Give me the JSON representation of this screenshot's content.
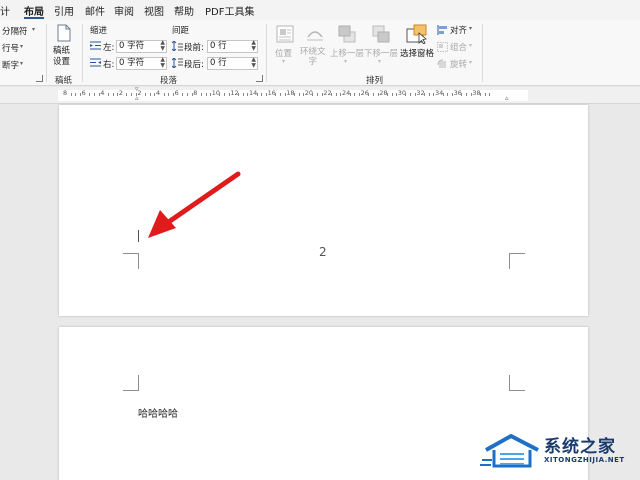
{
  "menu": {
    "tabs": [
      {
        "label": "计"
      },
      {
        "label": "布局"
      },
      {
        "label": "引用"
      },
      {
        "label": "邮件"
      },
      {
        "label": "审阅"
      },
      {
        "label": "视图"
      },
      {
        "label": "帮助"
      },
      {
        "label": "PDF工具集"
      }
    ],
    "active": "布局"
  },
  "ribbon": {
    "setup": {
      "breaks": "分隔符",
      "line_numbers": "行号",
      "hyphenation": "断字"
    },
    "draft": {
      "button": "稿纸\n设置",
      "group": "稿纸"
    },
    "paragraph": {
      "indent_title": "缩进",
      "spacing_title": "间距",
      "left_label": "左:",
      "right_label": "右:",
      "before_label": "段前:",
      "after_label": "段后:",
      "left_value": "0 字符",
      "right_value": "0 字符",
      "before_value": "0 行",
      "after_value": "0 行",
      "group": "段落"
    },
    "arrange": {
      "position": "位置",
      "wrap_text": "环绕文\n字",
      "bring_forward": "上移一层",
      "send_backward": "下移一层",
      "selection_pane": "选择窗格",
      "align": "对齐",
      "group_objects": "组合",
      "rotate": "旋转",
      "group": "排列"
    }
  },
  "ruler": {
    "numbers": [
      "8",
      "6",
      "4",
      "2",
      "2",
      "4",
      "6",
      "8",
      "10",
      "12",
      "14",
      "16",
      "18",
      "20",
      "22",
      "24",
      "26",
      "28",
      "30",
      "32",
      "34",
      "36",
      "38"
    ]
  },
  "document": {
    "page_number": "2",
    "body_text": "哈哈哈哈"
  },
  "watermark": {
    "title": "系统之家",
    "url": "XITONGZHIJIA.NET"
  },
  "colors": {
    "accent": "#2b579a",
    "arrow": "#e01b1b",
    "selection_highlight": "#f5c26b"
  }
}
